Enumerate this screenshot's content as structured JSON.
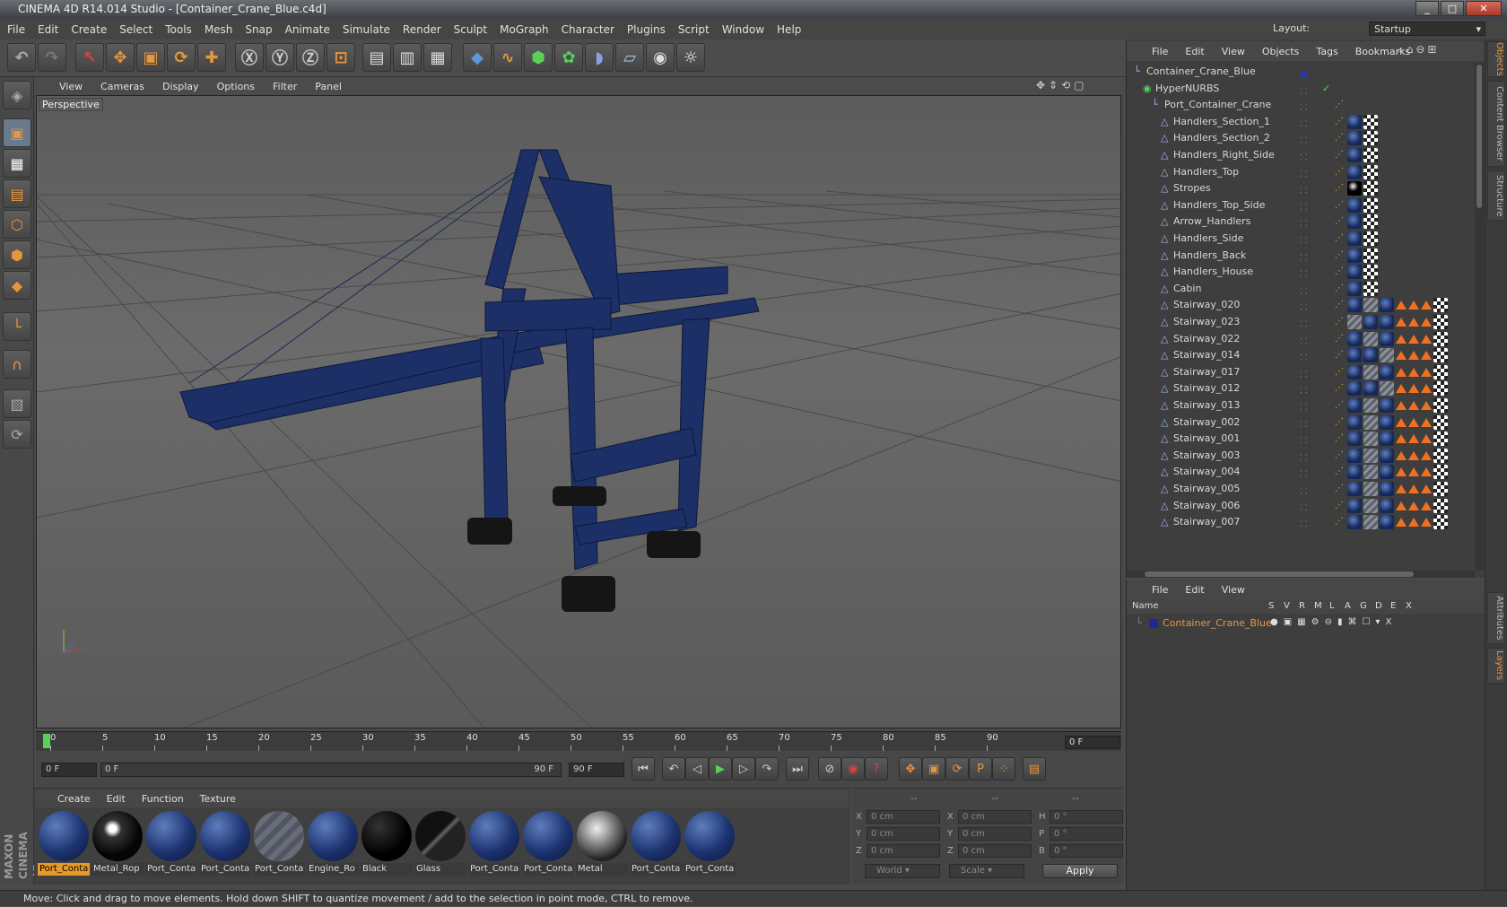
{
  "window": {
    "title": "CINEMA 4D R14.014 Studio - [Container_Crane_Blue.c4d]",
    "layout_label": "Layout:",
    "layout_value": "Startup"
  },
  "menu": [
    "File",
    "Edit",
    "Create",
    "Select",
    "Tools",
    "Mesh",
    "Snap",
    "Animate",
    "Simulate",
    "Render",
    "Sculpt",
    "MoGraph",
    "Character",
    "Plugins",
    "Script",
    "Window",
    "Help"
  ],
  "toolbar": {
    "icons": [
      "undo-icon",
      "redo-icon",
      "live-select-icon",
      "move-icon",
      "scale-icon",
      "rotate-icon",
      "add-icon",
      "x-axis-icon",
      "y-axis-icon",
      "z-axis-icon",
      "coord-system-icon",
      "render-view-icon",
      "render-picture-viewer-icon",
      "edit-render-settings-icon",
      "cube-icon",
      "spline-pen-icon",
      "subdivision-icon",
      "array-icon",
      "deformer-icon",
      "floor-icon",
      "camera-icon",
      "light-icon"
    ],
    "axis_x": "X",
    "axis_y": "Y",
    "axis_z": "Z"
  },
  "viewport": {
    "menu": [
      "View",
      "Cameras",
      "Display",
      "Options",
      "Filter",
      "Panel"
    ],
    "label": "Perspective",
    "model_color": "#1c2f66"
  },
  "timeline": {
    "ticks": [
      "0",
      "5",
      "10",
      "15",
      "20",
      "25",
      "30",
      "35",
      "40",
      "45",
      "50",
      "55",
      "60",
      "65",
      "70",
      "75",
      "80",
      "85",
      "90"
    ],
    "current_frame": "0 F",
    "start": "0 F",
    "slider_start": "0 F",
    "slider_end": "90 F",
    "end": "90 F"
  },
  "materials": {
    "menu": [
      "Create",
      "Edit",
      "Function",
      "Texture"
    ],
    "items": [
      {
        "label": "Port_Conta",
        "type": "blue",
        "selected": true
      },
      {
        "label": "Metal_Rop",
        "type": "rope"
      },
      {
        "label": "Port_Conta",
        "type": "blue"
      },
      {
        "label": "Port_Conta",
        "type": "blue"
      },
      {
        "label": "Port_Conta",
        "type": "stripe"
      },
      {
        "label": "Engine_Ro",
        "type": "blue"
      },
      {
        "label": "Black",
        "type": "black"
      },
      {
        "label": "Glass",
        "type": "glass"
      },
      {
        "label": "Port_Conta",
        "type": "blue"
      },
      {
        "label": "Port_Conta",
        "type": "blue"
      },
      {
        "label": "Metal",
        "type": "metal"
      },
      {
        "label": "Port_Conta",
        "type": "blue"
      },
      {
        "label": "Port_Conta",
        "type": "blue"
      }
    ]
  },
  "coords": {
    "headers": [
      "--",
      "--",
      "--"
    ],
    "rows": [
      {
        "a": "X",
        "av": "0 cm",
        "b": "X",
        "bv": "0 cm",
        "c": "H",
        "cv": "0 °"
      },
      {
        "a": "Y",
        "av": "0 cm",
        "b": "Y",
        "bv": "0 cm",
        "c": "P",
        "cv": "0 °"
      },
      {
        "a": "Z",
        "av": "0 cm",
        "b": "Z",
        "bv": "0 cm",
        "c": "B",
        "cv": "0 °"
      }
    ],
    "world": "World",
    "scale": "Scale",
    "apply": "Apply"
  },
  "status": "Move: Click and drag to move elements. Hold down SHIFT to quantize movement / add to the selection in point mode, CTRL to remove.",
  "objects": {
    "menu": [
      "File",
      "Edit",
      "View",
      "Objects",
      "Tags",
      "Bookmarks"
    ],
    "rows": [
      {
        "name": "Container_Crane_Blue",
        "indent": 0,
        "tags": []
      },
      {
        "name": "HyperNURBS",
        "indent": 1,
        "tags": []
      },
      {
        "name": "Port_Container_Crane",
        "indent": 2,
        "tags": [
          "ph"
        ]
      },
      {
        "name": "Handlers_Section_1",
        "indent": 3,
        "tags": [
          "ph",
          "m",
          "c"
        ]
      },
      {
        "name": "Handlers_Section_2",
        "indent": 3,
        "tags": [
          "ph",
          "m",
          "c"
        ]
      },
      {
        "name": "Handlers_Right_Side",
        "indent": 3,
        "tags": [
          "ph",
          "m",
          "c"
        ]
      },
      {
        "name": "Handlers_Top",
        "indent": 3,
        "tags": [
          "ph",
          "m",
          "c"
        ]
      },
      {
        "name": "Stropes",
        "indent": 3,
        "tags": [
          "ph",
          "mb",
          "c"
        ]
      },
      {
        "name": "Handlers_Top_Side",
        "indent": 3,
        "tags": [
          "ph",
          "m",
          "c"
        ]
      },
      {
        "name": "Arrow_Handlers",
        "indent": 3,
        "tags": [
          "ph",
          "m",
          "c"
        ]
      },
      {
        "name": "Handlers_Side",
        "indent": 3,
        "tags": [
          "ph",
          "m",
          "c"
        ]
      },
      {
        "name": "Handlers_Back",
        "indent": 3,
        "tags": [
          "ph",
          "m",
          "c"
        ]
      },
      {
        "name": "Handlers_House",
        "indent": 3,
        "tags": [
          "ph",
          "m",
          "c"
        ]
      },
      {
        "name": "Cabin",
        "indent": 3,
        "tags": [
          "ph",
          "m",
          "c"
        ]
      },
      {
        "name": "Stairway_020",
        "indent": 3,
        "tags": [
          "ph",
          "m",
          "s",
          "m",
          "p",
          "p",
          "p",
          "c"
        ]
      },
      {
        "name": "Stairway_023",
        "indent": 3,
        "tags": [
          "ph",
          "s",
          "m",
          "m",
          "p",
          "p",
          "p",
          "c"
        ]
      },
      {
        "name": "Stairway_022",
        "indent": 3,
        "tags": [
          "ph",
          "m",
          "s",
          "m",
          "p",
          "p",
          "p",
          "c"
        ]
      },
      {
        "name": "Stairway_014",
        "indent": 3,
        "tags": [
          "ph",
          "m",
          "m",
          "s",
          "p",
          "p",
          "p",
          "c"
        ]
      },
      {
        "name": "Stairway_017",
        "indent": 3,
        "tags": [
          "ph",
          "m",
          "s",
          "m",
          "p",
          "p",
          "p",
          "c"
        ]
      },
      {
        "name": "Stairway_012",
        "indent": 3,
        "tags": [
          "ph",
          "m",
          "m",
          "s",
          "p",
          "p",
          "p",
          "c"
        ]
      },
      {
        "name": "Stairway_013",
        "indent": 3,
        "tags": [
          "ph",
          "m",
          "s",
          "m",
          "p",
          "p",
          "p",
          "c"
        ]
      },
      {
        "name": "Stairway_002",
        "indent": 3,
        "tags": [
          "ph",
          "m",
          "s",
          "m",
          "p",
          "p",
          "p",
          "c"
        ]
      },
      {
        "name": "Stairway_001",
        "indent": 3,
        "tags": [
          "ph",
          "m",
          "s",
          "m",
          "p",
          "p",
          "p",
          "c"
        ]
      },
      {
        "name": "Stairway_003",
        "indent": 3,
        "tags": [
          "ph",
          "m",
          "s",
          "m",
          "p",
          "p",
          "p",
          "c"
        ]
      },
      {
        "name": "Stairway_004",
        "indent": 3,
        "tags": [
          "ph",
          "m",
          "s",
          "m",
          "p",
          "p",
          "p",
          "c"
        ]
      },
      {
        "name": "Stairway_005",
        "indent": 3,
        "tags": [
          "ph",
          "m",
          "s",
          "m",
          "p",
          "p",
          "p",
          "c"
        ]
      },
      {
        "name": "Stairway_006",
        "indent": 3,
        "tags": [
          "ph",
          "m",
          "s",
          "m",
          "p",
          "p",
          "p",
          "c"
        ]
      },
      {
        "name": "Stairway_007",
        "indent": 3,
        "tags": [
          "ph",
          "m",
          "s",
          "m",
          "p",
          "p",
          "p",
          "c"
        ]
      }
    ]
  },
  "layers": {
    "menu": [
      "File",
      "Edit",
      "View"
    ],
    "header_name": "Name",
    "columns": [
      "S",
      "V",
      "R",
      "M",
      "L",
      "A",
      "G",
      "D",
      "E",
      "X"
    ],
    "row": "Container_Crane_Blue"
  },
  "side_tabs": [
    "Objects",
    "Content Browser",
    "Structure",
    "Attributes",
    "Layers"
  ],
  "brand": "MAXON CINEMA 4D"
}
